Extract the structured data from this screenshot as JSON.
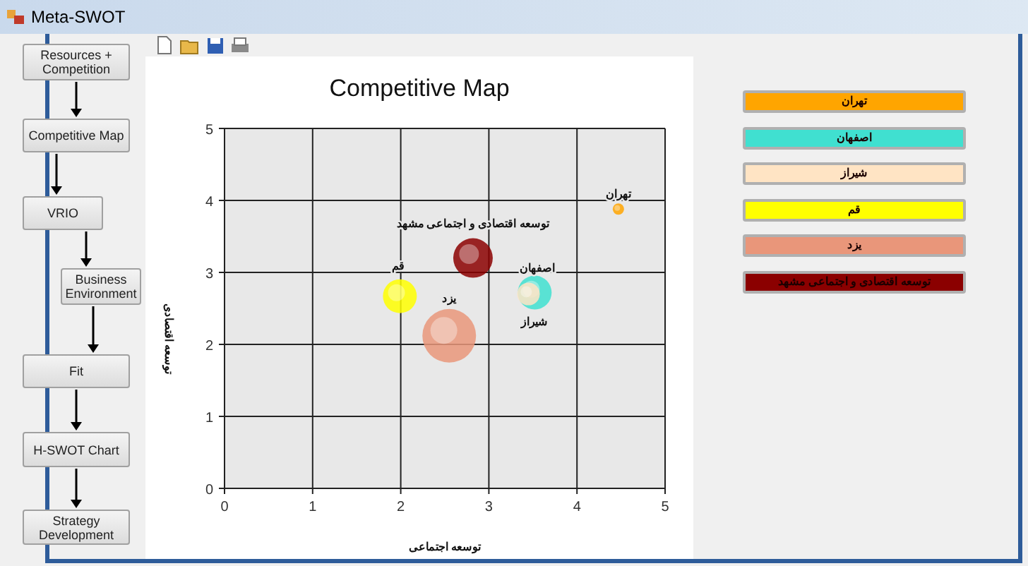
{
  "window": {
    "title": "Meta-SWOT"
  },
  "steps": [
    {
      "label": "Resources + Competition"
    },
    {
      "label": "Competitive Map"
    },
    {
      "label": "VRIO"
    },
    {
      "label": "Business Environment"
    },
    {
      "label": "Fit"
    },
    {
      "label": "H-SWOT Chart"
    },
    {
      "label": "Strategy Development"
    }
  ],
  "chart": {
    "chart_data": {
      "type": "scatter",
      "title": "Competitive Map",
      "xlabel": "توسعه اجتماعی",
      "ylabel": "توسعه اقتصادی",
      "xlim": [
        0,
        5
      ],
      "ylim": [
        0,
        5
      ],
      "xticks": [
        0,
        1,
        2,
        3,
        4,
        5
      ],
      "yticks": [
        0,
        1,
        2,
        3,
        4,
        5
      ],
      "grid": true,
      "series": [
        {
          "name": "تهران",
          "color": "#ffa500",
          "x": [
            4.47
          ],
          "values": [
            3.88
          ]
        },
        {
          "name": "توسعه اقتصادی و اجتماعی مشهد",
          "color": "#8b0000",
          "x": [
            2.82
          ],
          "values": [
            3.2
          ]
        },
        {
          "name": "اصفهان",
          "color": "#40e0d0",
          "x": [
            3.52
          ],
          "values": [
            2.72
          ]
        },
        {
          "name": "شیراز",
          "color": "#ffe4c4",
          "x": [
            3.45
          ],
          "values": [
            2.7
          ]
        },
        {
          "name": "قم",
          "color": "#ffff00",
          "x": [
            1.99
          ],
          "values": [
            2.67
          ]
        },
        {
          "name": "یزد",
          "color": "#e9967a",
          "x": [
            2.55
          ],
          "values": [
            2.12
          ]
        }
      ]
    }
  },
  "legend": [
    {
      "label": "تهران",
      "color": "#ffa500"
    },
    {
      "label": "اصفهان",
      "color": "#40e0d0"
    },
    {
      "label": "شیراز",
      "color": "#ffe4c4"
    },
    {
      "label": "قم",
      "color": "#ffff00"
    },
    {
      "label": "یزد",
      "color": "#e9967a"
    },
    {
      "label": "توسعه اقتصادی و اجتماعی مشهد",
      "color": "#8b0000"
    }
  ]
}
